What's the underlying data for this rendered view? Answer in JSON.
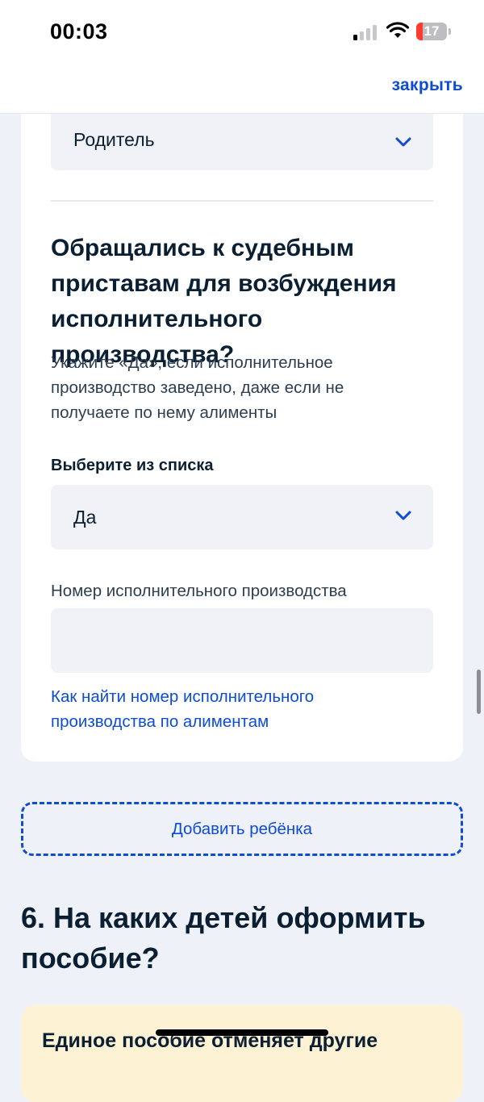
{
  "status_bar": {
    "time": "00:03",
    "battery_level": "17",
    "icons": [
      "cellular-signal-icon",
      "wifi-icon",
      "battery-icon"
    ]
  },
  "nav": {
    "close_label": "закрыть"
  },
  "form_card": {
    "relation_select": {
      "value": "Родитель"
    },
    "bailiffs_question": {
      "title": "Обращались к судебным приставам для возбуждения исполнительного производства?",
      "hint": "Укажите «Да», если исполнительное производство заведено, даже если не получаете по нему алименты",
      "select_label": "Выберите из списка",
      "select_value": "Да"
    },
    "proceeding_number": {
      "label": "Номер исполнительного производства",
      "value": "",
      "help_link": "Как найти номер исполнительного производства по алиментам"
    }
  },
  "add_child_button": "Добавить ребёнка",
  "section6": {
    "title": "6. На каких детей оформить пособие?",
    "notice_text": "Единое пособие отменяет другие"
  },
  "colors": {
    "accent": "#0d4cd3",
    "page_background": "#eef1f7",
    "card_background": "#ffffff",
    "input_background": "#f0f2f7",
    "notice_background": "#fef2d4",
    "text_primary": "#0b1f33",
    "battery_low": "#ff3b30"
  }
}
